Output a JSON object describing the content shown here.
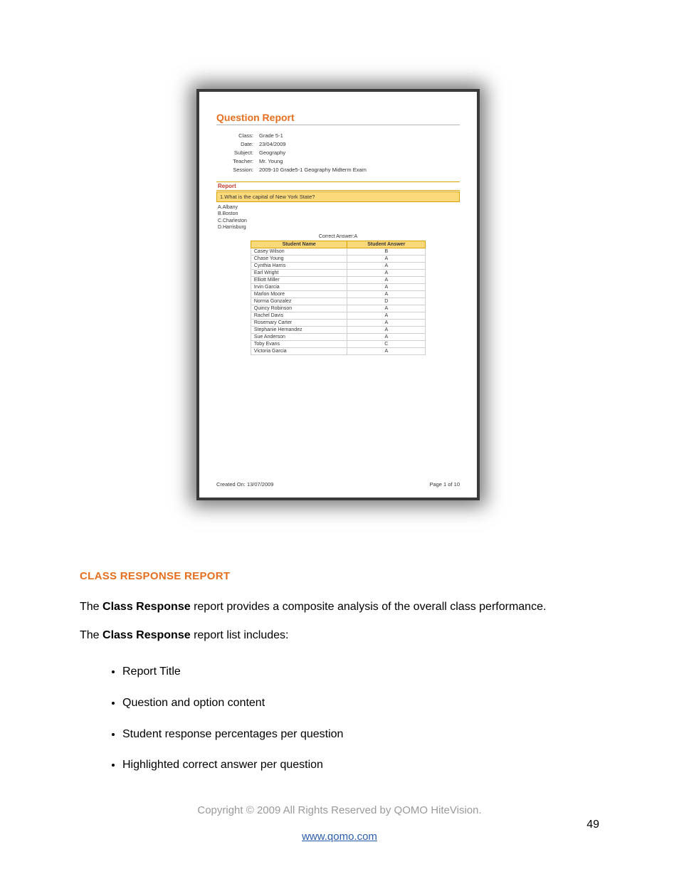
{
  "report": {
    "title": "Question Report",
    "meta": {
      "class_label": "Class:",
      "class_value": "Grade 5-1",
      "date_label": "Date:",
      "date_value": "23/04/2009",
      "subject_label": "Subject:",
      "subject_value": "Geography",
      "teacher_label": "Teacher:",
      "teacher_value": "Mr. Young",
      "session_label": "Session:",
      "session_value": "2009-10 Grade5-1 Geography Midterm Exam"
    },
    "section_head": "Report",
    "question": "1.What is the capital of New York State?",
    "options": [
      "A.Albany",
      "B.Boston",
      "C.Charleston",
      "D.Harrisburg"
    ],
    "correct": "Correct Answer:A",
    "table": {
      "head_name": "Student Name",
      "head_answer": "Student Answer",
      "rows": [
        {
          "name": "Casey Wilson",
          "ans": "B"
        },
        {
          "name": "Chase Young",
          "ans": "A"
        },
        {
          "name": "Cynthia Harris",
          "ans": "A"
        },
        {
          "name": "Earl Wright",
          "ans": "A"
        },
        {
          "name": "Elliott Miller",
          "ans": "A"
        },
        {
          "name": "Irvin Garcia",
          "ans": "A"
        },
        {
          "name": "Marlon Moore",
          "ans": "A"
        },
        {
          "name": "Norma Gonzalez",
          "ans": "D"
        },
        {
          "name": "Quincy Robinson",
          "ans": "A"
        },
        {
          "name": "Rachel Davis",
          "ans": "A"
        },
        {
          "name": "Rosemary Carter",
          "ans": "A"
        },
        {
          "name": "Stephanie Hernandez",
          "ans": "A"
        },
        {
          "name": "Sue Anderson",
          "ans": "A"
        },
        {
          "name": "Toby Evans",
          "ans": "C"
        },
        {
          "name": "Victoria Garcia",
          "ans": "A"
        }
      ]
    },
    "created_label": "Created On: 13/07/2009",
    "page_label": "Page 1 of 10"
  },
  "body": {
    "heading": "CLASS RESPONSE REPORT",
    "p1_prefix": "The ",
    "p1_bold": "Class Response",
    "p1_suffix": " report provides a composite analysis of the overall class performance.",
    "p2_prefix": "The ",
    "p2_bold": "Class Response",
    "p2_suffix": " report list includes:",
    "bullets": [
      "Report Title",
      "Question and option content",
      "Student response percentages per question",
      "Highlighted correct answer per question"
    ]
  },
  "footer": {
    "copyright": "Copyright © 2009 All Rights Reserved by QOMO HiteVision.",
    "link": "www.qomo.com",
    "page_num": "49"
  }
}
